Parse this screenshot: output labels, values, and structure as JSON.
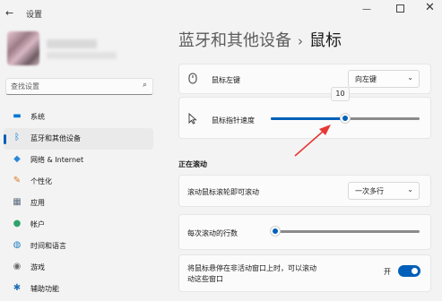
{
  "window": {
    "title": "设置",
    "back_glyph": "←",
    "min_glyph": "—",
    "close_glyph": "✕"
  },
  "search": {
    "placeholder": "查找设置",
    "icon": "search-icon"
  },
  "sidebar": {
    "items": [
      {
        "label": "系统",
        "icon": "monitor-icon",
        "glyph": "▬",
        "color": "#0078d4",
        "active": false
      },
      {
        "label": "蓝牙和其他设备",
        "icon": "bluetooth-icon",
        "glyph": "ᛒ",
        "color": "#0078d4",
        "active": true
      },
      {
        "label": "网络 & Internet",
        "icon": "wifi-icon",
        "glyph": "◆",
        "color": "#2b88d8",
        "active": false
      },
      {
        "label": "个性化",
        "icon": "brush-icon",
        "glyph": "✎",
        "color": "#d97b1f",
        "active": false
      },
      {
        "label": "应用",
        "icon": "apps-icon",
        "glyph": "▦",
        "color": "#5a6b7d",
        "active": false
      },
      {
        "label": "帐户",
        "icon": "account-icon",
        "glyph": "●",
        "color": "#2fa36b",
        "active": false
      },
      {
        "label": "时间和语言",
        "icon": "globe-icon",
        "glyph": "◍",
        "color": "#1f7fc4",
        "active": false
      },
      {
        "label": "游戏",
        "icon": "gamepad-icon",
        "glyph": "◉",
        "color": "#6b6b6b",
        "active": false
      },
      {
        "label": "辅助功能",
        "icon": "accessibility-icon",
        "glyph": "✱",
        "color": "#1f6fb5",
        "active": false
      }
    ]
  },
  "breadcrumb": {
    "parent": "蓝牙和其他设备",
    "separator": "›",
    "current": "鼠标"
  },
  "settings": {
    "primary_button": {
      "label": "鼠标左键",
      "icon": "mouse-icon",
      "value": "向左键"
    },
    "pointer_speed": {
      "label": "鼠标指针速度",
      "icon": "cursor-icon",
      "value": 10,
      "max": 20,
      "tooltip": "10"
    },
    "scrolling_header": "正在滚动",
    "scroll_mode": {
      "label": "滚动鼠标滚轮即可滚动",
      "value": "一次多行"
    },
    "lines_per_scroll": {
      "label": "每次滚动的行数",
      "value": 3,
      "max": 100
    },
    "inactive_scroll": {
      "label_line1": "将鼠标悬停在非活动窗口上时，可以滚动",
      "label_line2": "动这些窗口",
      "state": "开",
      "on": true
    }
  },
  "colors": {
    "accent": "#005fb8",
    "annotation": "#e53935"
  },
  "chevron": "⌄"
}
